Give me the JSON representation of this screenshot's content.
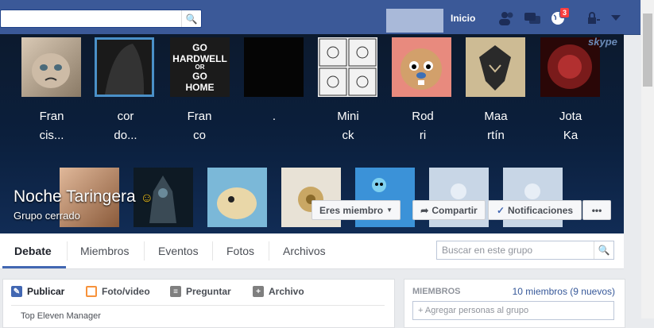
{
  "topbar": {
    "search_placeholder": "",
    "home_label": "Inicio",
    "notification_count": "3"
  },
  "cover": {
    "members_row1": [
      {
        "name_line1": "Fran",
        "name_line2": "cis..."
      },
      {
        "name_line1": "cor",
        "name_line2": "do..."
      },
      {
        "name_line1": "Fran",
        "name_line2": "co"
      },
      {
        "name_line1": ".",
        "name_line2": ""
      },
      {
        "name_line1": "Mini",
        "name_line2": "ck"
      },
      {
        "name_line1": "Rod",
        "name_line2": "ri"
      },
      {
        "name_line1": "Maa",
        "name_line2": "rtín"
      },
      {
        "name_line1": "Jota",
        "name_line2": "Ka"
      }
    ],
    "thumb_text": {
      "go_line1": "GO",
      "go_line2": "HARDWELL",
      "go_line3": "OR",
      "go_line4": "GO",
      "go_line5": "HOME",
      "skype": "skype"
    },
    "group_title": "Noche Taringera",
    "group_subtitle": "Grupo cerrado",
    "buttons": {
      "member": "Eres miembro",
      "share": "Compartir",
      "notifications": "Notificaciones",
      "more": "•••"
    }
  },
  "nav": {
    "tabs": [
      "Debate",
      "Miembros",
      "Eventos",
      "Fotos",
      "Archivos"
    ],
    "search_placeholder": "Buscar en este grupo"
  },
  "composer": {
    "items": [
      "Publicar",
      "Foto/video",
      "Preguntar",
      "Archivo"
    ],
    "partial_text": "Top Eleven Manager"
  },
  "members_box": {
    "header": "MIEMBROS",
    "count": "10 miembros (9 nuevos)",
    "add_placeholder": "+ Agregar personas al grupo"
  }
}
